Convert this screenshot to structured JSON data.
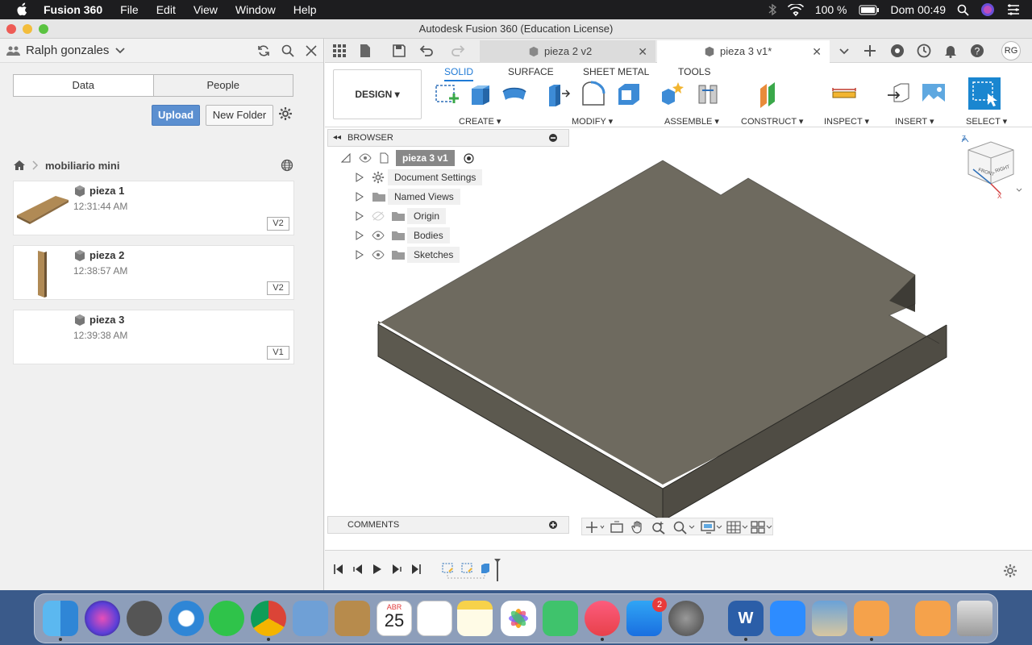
{
  "menubar": {
    "app": "Fusion 360",
    "items": [
      "File",
      "Edit",
      "View",
      "Window",
      "Help"
    ],
    "battery": "100 %",
    "clock": "Dom 00:49"
  },
  "window": {
    "title": "Autodesk Fusion 360 (Education License)"
  },
  "left_panel": {
    "user": "Ralph gonzales",
    "tabs": [
      "Data",
      "People"
    ],
    "upload_label": "Upload",
    "new_folder_label": "New Folder",
    "folder": "mobiliario mini",
    "files": [
      {
        "name": "pieza 1",
        "time": "12:31:44 AM",
        "version": "V2"
      },
      {
        "name": "pieza 2",
        "time": "12:38:57 AM",
        "version": "V2"
      },
      {
        "name": "pieza 3",
        "time": "12:39:38 AM",
        "version": "V1"
      }
    ]
  },
  "tabs": [
    {
      "label": "pieza 2 v2"
    },
    {
      "label": "pieza 3 v1*"
    }
  ],
  "avatar": "RG",
  "ribbon": {
    "workspace": "DESIGN",
    "tabs": [
      "SOLID",
      "SURFACE",
      "SHEET METAL",
      "TOOLS"
    ],
    "groups": [
      "CREATE",
      "MODIFY",
      "ASSEMBLE",
      "CONSTRUCT",
      "INSPECT",
      "INSERT",
      "SELECT"
    ]
  },
  "browser": {
    "header": "BROWSER",
    "root": "pieza 3 v1",
    "nodes": [
      "Document Settings",
      "Named Views",
      "Origin",
      "Bodies",
      "Sketches"
    ]
  },
  "viewcube": {
    "front": "FRONT",
    "right": "RIGHT",
    "axis_x": "X",
    "axis_z": "Z"
  },
  "comments": {
    "header": "COMMENTS"
  },
  "dock": {
    "calendar_month": "ABR",
    "calendar_day": "25",
    "appstore_badge": "2"
  },
  "colors": {
    "accent": "#1f7ad6",
    "upload": "#5b8fd0",
    "body": "#6b675c"
  }
}
